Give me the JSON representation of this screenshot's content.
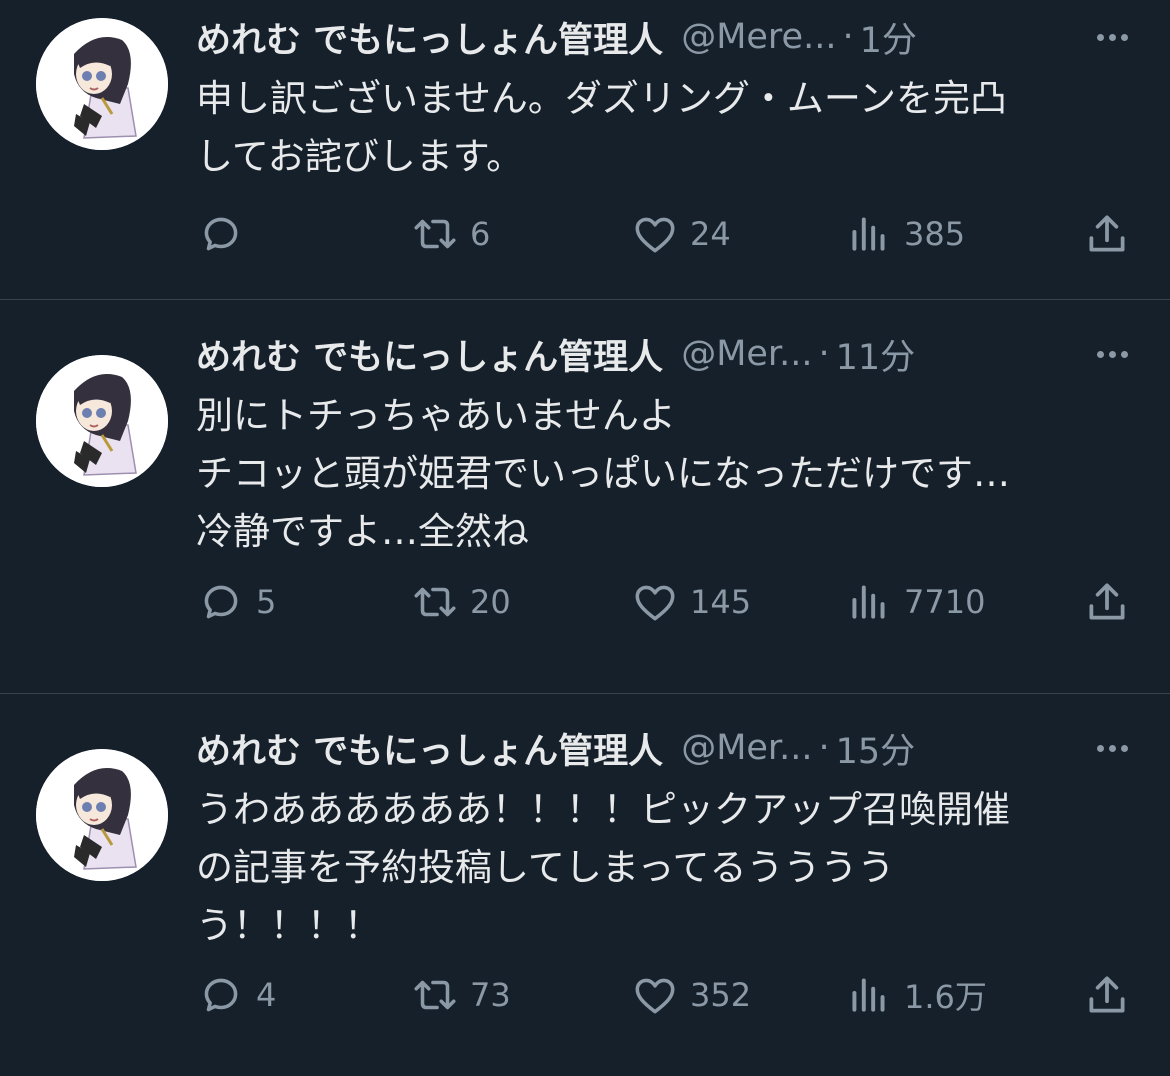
{
  "tweets": [
    {
      "display_name": "めれむ でもにっしょん管理人",
      "handle": "@Mere...",
      "separator": "·",
      "time": "1分",
      "text_lines": [
        "申し訳ございません。ダズリング・ムーンを完凸",
        "してお詫びします。"
      ],
      "reply_count": "",
      "retweet_count": "6",
      "like_count": "24",
      "view_count": "385"
    },
    {
      "display_name": "めれむ でもにっしょん管理人",
      "handle": "@Mer...",
      "separator": "·",
      "time": "11分",
      "text_lines": [
        "別にトチっちゃあいませんよ",
        "チコッと頭が姫君でいっぱいになっただけです…",
        "冷静ですよ…全然ね"
      ],
      "reply_count": "5",
      "retweet_count": "20",
      "like_count": "145",
      "view_count": "7710"
    },
    {
      "display_name": "めれむ でもにっしょん管理人",
      "handle": "@Mer...",
      "separator": "·",
      "time": "15分",
      "text_lines": [
        "うわああああああ！！！！ピックアップ召喚開催",
        "の記事を予約投稿してしまってるうううう",
        "う！！！！"
      ],
      "reply_count": "4",
      "retweet_count": "73",
      "like_count": "352",
      "view_count": "1.6万"
    }
  ],
  "icons": {
    "avatar": "anime-character-avatar",
    "more": "more-horizontal-icon",
    "reply": "reply-bubble-icon",
    "retweet": "retweet-icon",
    "like": "heart-icon",
    "views": "views-bar-chart-icon",
    "share": "share-upload-icon"
  },
  "colors": {
    "background": "#15202b",
    "text": "#e7e9ea",
    "secondary": "#8b98a5",
    "divider": "#38444d"
  }
}
